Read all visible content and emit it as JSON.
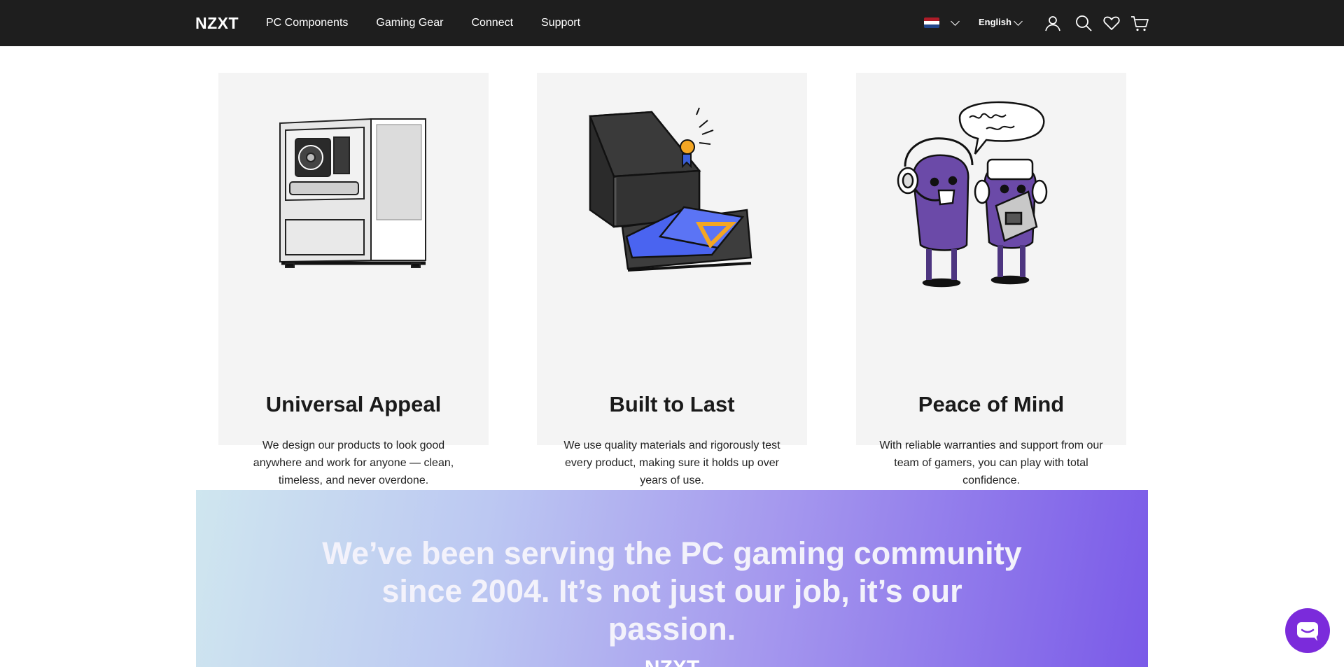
{
  "header": {
    "logo": "NZXT",
    "nav": [
      "PC Components",
      "Gaming Gear",
      "Connect",
      "Support"
    ],
    "language": "English",
    "region_flag": "Netherlands",
    "icons": [
      "user-icon",
      "search-icon",
      "heart-icon",
      "cart-icon"
    ]
  },
  "features": [
    {
      "title": "Universal Appeal",
      "text": "We design our products to look good anywhere and work for anyone — clean, timeless, and never overdone.",
      "illustration": "pc-case"
    },
    {
      "title": "Built to Last",
      "text": "We use quality materials and rigorously test every product, making sure it holds up over years of use.",
      "illustration": "case-with-blueprints"
    },
    {
      "title": "Peace of Mind",
      "text": "With reliable warranties and support from our team of gamers, you can play with total confidence.",
      "illustration": "support-characters"
    }
  ],
  "banner": {
    "text": "We’ve been serving the PC gaming community since 2004. It’s not just our job, it’s our passion.",
    "logo": "NZXT"
  },
  "colors": {
    "nav_bg": "#1e1e1e",
    "card_bg": "#f4f4f4",
    "chat_button": "#7b2bdb"
  }
}
